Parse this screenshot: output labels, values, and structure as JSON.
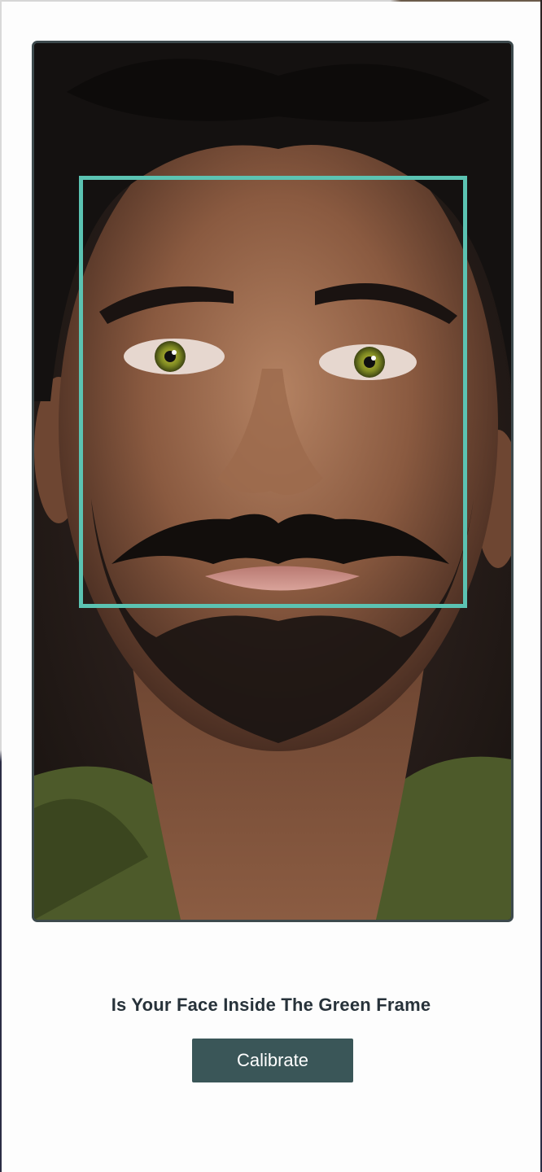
{
  "camera": {
    "feed_subject": "camera-preview",
    "frame_color": "#5bc3b2"
  },
  "calibration": {
    "prompt": "Is Your Face Inside The Green Frame",
    "button_label": "Calibrate",
    "button_color": "#3a5658"
  }
}
